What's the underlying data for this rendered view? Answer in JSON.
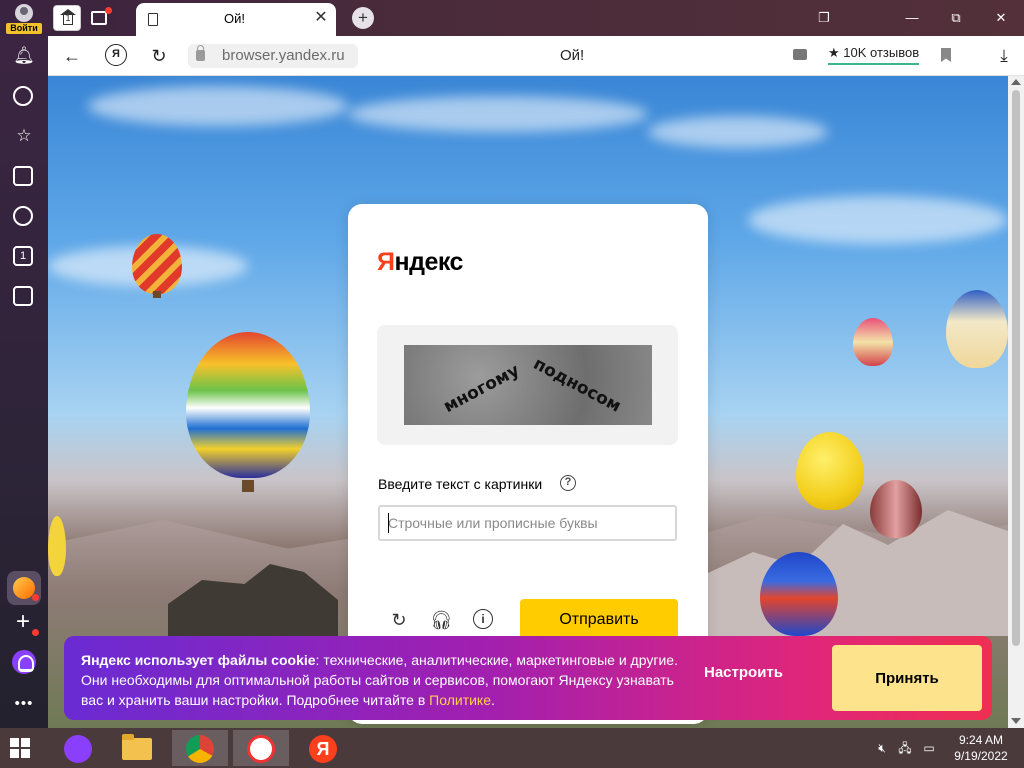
{
  "browser": {
    "signin_label": "Войти",
    "home_tab_count": "1",
    "tab_title": "Ой!",
    "add_tab_symbol": "+",
    "url_host": "browser.yandex.ru",
    "page_title": "Ой!",
    "reviews_label": "★ 10K отзывов",
    "yandex_button": "Я",
    "tab_count_badge": "1",
    "window_icons": [
      "collections-icon",
      "minimize-icon",
      "restore-icon",
      "close-icon"
    ]
  },
  "sidebar": {
    "items": [
      "bell-icon",
      "history-icon",
      "star-icon",
      "notes-icon",
      "play-icon",
      "counter-icon",
      "screenshot-icon"
    ],
    "bottom": [
      "zen-tile",
      "add-tile",
      "alice-icon",
      "more-icon"
    ]
  },
  "captcha": {
    "logo_first": "Я",
    "logo_rest": "ндекс",
    "captcha_word_1": "многому",
    "captcha_word_2": "подносом",
    "prompt": "Введите текст с картинки",
    "help_symbol": "?",
    "input_value": "",
    "input_placeholder": "Строчные или прописные буквы",
    "info_symbol": "i",
    "submit_label": "Отправить"
  },
  "cookie_banner": {
    "bold_text": "Яндекс использует файлы cookie",
    "text": ": технические, аналитические, маркетинговые и другие. Они необходимы для оптимальной работы сайтов и сервисов, помогают Яндексу узнавать вас и хранить ваши настройки. Подробнее читайте в ",
    "link_text": "Политике",
    "after_link": ".",
    "settings_label": "Настроить",
    "accept_label": "Принять"
  },
  "taskbar": {
    "apps": [
      "start-button",
      "alice-app",
      "file-explorer",
      "chrome",
      "yandex-browser",
      "yandex"
    ],
    "time": "9:24 AM",
    "date": "9/19/2022"
  },
  "colors": {
    "yandex_red": "#fc3f1d",
    "submit_yellow": "#ffcc00",
    "accept_yellow": "#fde38b",
    "policy_link": "#ffd24a"
  }
}
